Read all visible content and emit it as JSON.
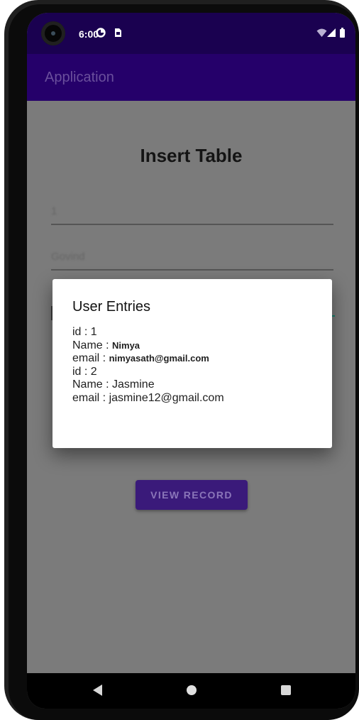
{
  "status_bar": {
    "time": "6:00",
    "icons": [
      "data-saver-icon",
      "sim-card-icon",
      "wifi-icon",
      "signal-icon",
      "battery-icon"
    ]
  },
  "app_bar": {
    "title": "Application"
  },
  "page": {
    "title": "Insert Table",
    "fields": [
      {
        "value": "1"
      },
      {
        "value": "Govind"
      }
    ],
    "view_button_label": "VIEW RECORD"
  },
  "dialog": {
    "title": "User Entries",
    "entries": [
      {
        "id_line": "id : 1",
        "name_prefix": "Name : ",
        "name": "Nimya",
        "email_prefix": "email : ",
        "email": "nimyasath@gmail.com"
      },
      {
        "id_line": "id : 2",
        "name_prefix": "Name : ",
        "name": "Jasmine",
        "email_prefix": "email : ",
        "email": "jasmine12@gmail.com"
      }
    ]
  },
  "colors": {
    "status_bar": "#1a0150",
    "app_bar": "#25006a",
    "scrim": "#7b7b7b",
    "button": "#3a1a7a",
    "dialog": "#ffffff"
  },
  "nav_bar": {
    "icons": [
      "back-icon",
      "home-icon",
      "recents-icon"
    ]
  }
}
